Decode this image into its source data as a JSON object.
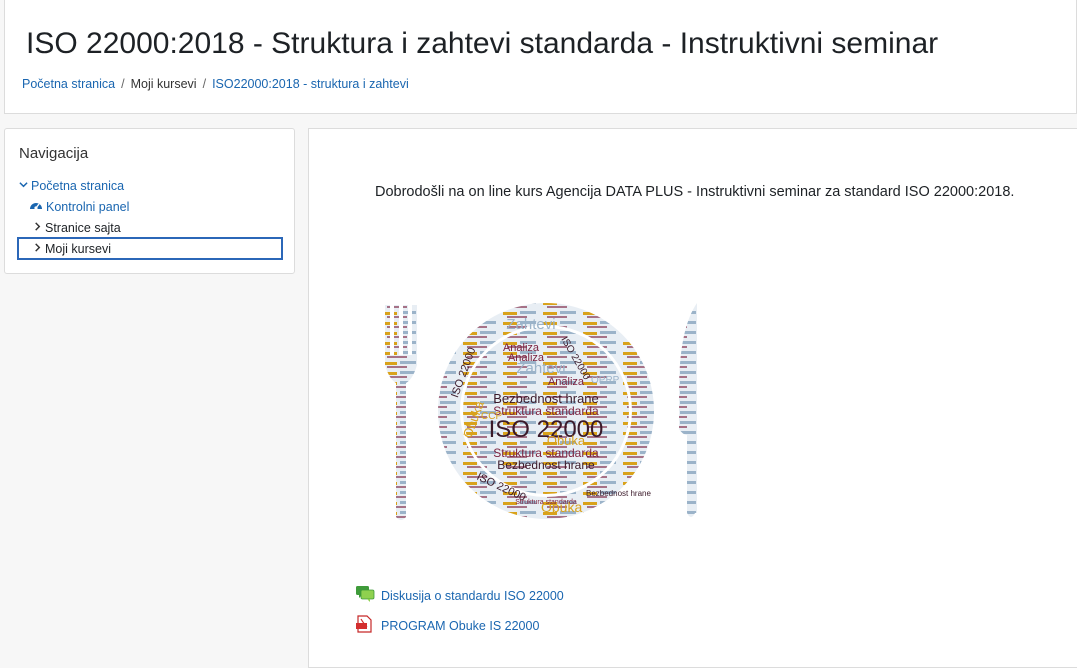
{
  "header": {
    "title": "ISO 22000:2018 - Struktura i zahtevi standarda - Instruktivni seminar",
    "breadcrumb": [
      {
        "label": "Početna stranica",
        "link": true
      },
      {
        "label": "Moji kursevi",
        "link": false
      },
      {
        "label": "ISO22000:2018 - struktura i zahtevi",
        "link": true
      }
    ]
  },
  "navigation": {
    "title": "Navigacija",
    "items": [
      {
        "label": "Početna stranica",
        "icon": "chevron-down-icon"
      },
      {
        "label": "Kontrolni panel",
        "icon": "dashboard-icon"
      },
      {
        "label": "Stranice sajta",
        "icon": "chevron-right-icon"
      },
      {
        "label": "Moji kursevi",
        "icon": "chevron-right-icon"
      }
    ]
  },
  "main": {
    "welcome": "Dobrodošli na on line kurs Agencija DATA PLUS  - Instruktivni seminar za standard ISO 22000:2018.",
    "image_words": {
      "center": "ISO 22000",
      "lines": [
        "Bezbednost hrane",
        "Struktura standarda",
        "Obuka",
        "Struktura standarda",
        "Bezbednost hrane"
      ],
      "ring": [
        "Zahtevi",
        "Analiza",
        "Analiza",
        "Zahtevi",
        "Analiza",
        "ISO 22000",
        "ISO 22000",
        "Obuka",
        "ISO 22000",
        "Obuka",
        "CCP",
        "OPRP",
        "Bezbednost hrane",
        "Struktura standarda"
      ]
    },
    "activities": [
      {
        "label": "Diskusija o standardu ISO 22000",
        "icon": "forum-icon"
      },
      {
        "label": "PROGRAM Obuke IS 22000",
        "icon": "pdf-icon"
      }
    ]
  },
  "colors": {
    "link": "#1a66b0",
    "focus": "#2b67b8",
    "wine": "#7a1f3d",
    "gold": "#d9a21b",
    "steel": "#9bb3c9"
  }
}
